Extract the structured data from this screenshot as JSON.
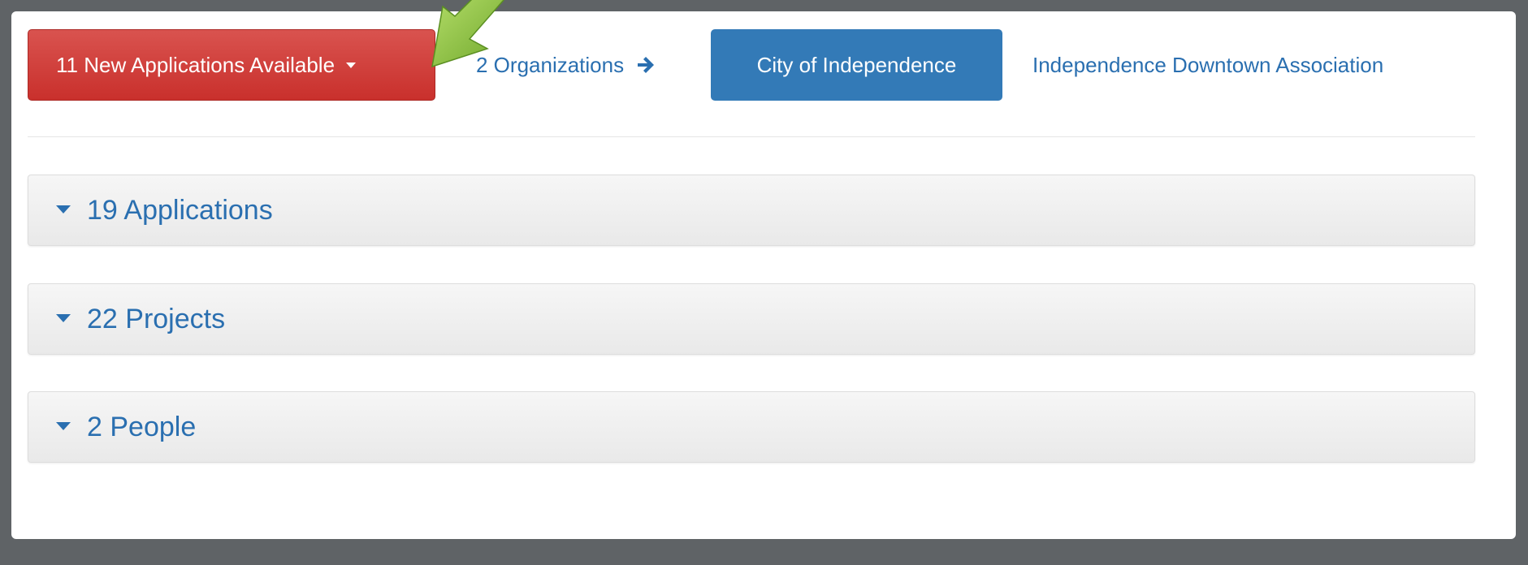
{
  "toolbar": {
    "new_applications_label": "11 New Applications Available",
    "organizations_link": "2 Organizations",
    "city_button": "City of Independence",
    "association_link": "Independence Downtown Association"
  },
  "panels": [
    {
      "label": "19 Applications"
    },
    {
      "label": "22 Projects"
    },
    {
      "label": "2 People"
    }
  ],
  "colors": {
    "danger": "#d9534f",
    "primary": "#337ab7",
    "link": "#2a6fb0",
    "annotation_arrow": "#8cc63f"
  },
  "icons": {
    "dropdown": "caret-down-icon",
    "organizations_arrow": "arrow-right-icon",
    "panel_toggle": "triangle-down-icon",
    "annotation": "annotation-arrow-icon"
  }
}
